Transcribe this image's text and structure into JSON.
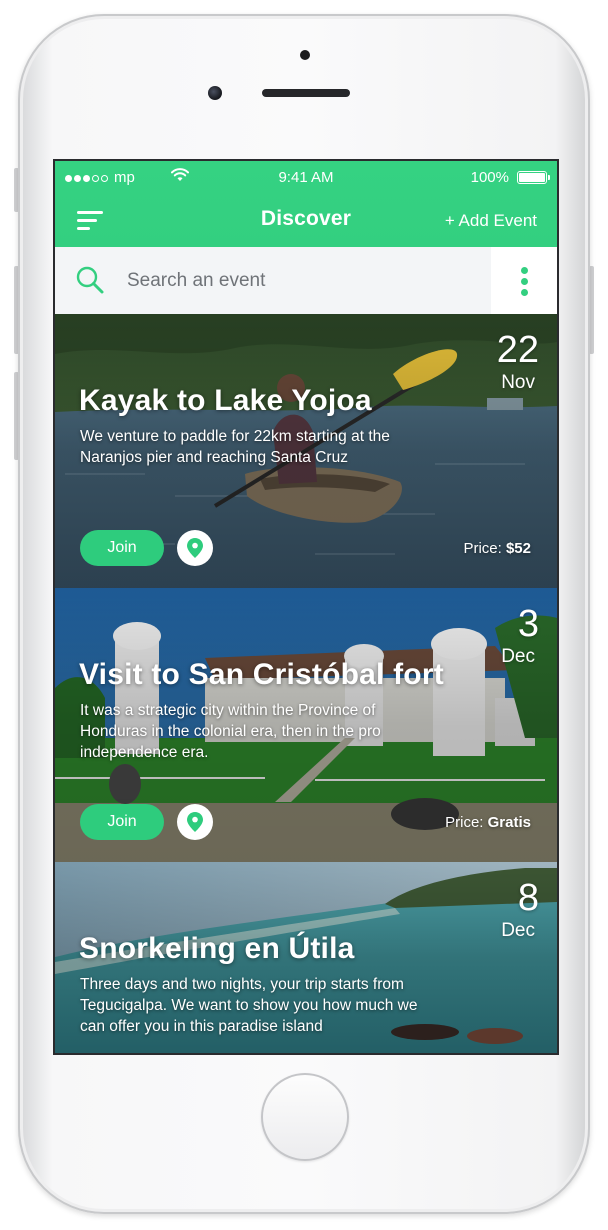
{
  "status_bar": {
    "carrier": "mp",
    "time": "9:41 AM",
    "battery": "100%"
  },
  "nav": {
    "title": "Discover",
    "add_event_label": "+ Add Event",
    "menu_icon": "hamburger-menu-icon"
  },
  "search": {
    "placeholder": "Search an event",
    "value": ""
  },
  "events": [
    {
      "day": "22",
      "month": "Nov",
      "title": "Kayak to Lake Yojoa",
      "description": "We venture to paddle for 22km starting at the Naranjos pier and reaching Santa Cruz",
      "join_label": "Join",
      "price_label": "Price:",
      "price_value": "$52"
    },
    {
      "day": "3",
      "month": "Dec",
      "title": "Visit to San Cristóbal fort",
      "description": "It was a strategic city within the Province of Honduras in the colonial era, then in the pro independence era.",
      "join_label": "Join",
      "price_label": "Price:",
      "price_value": "Gratis"
    },
    {
      "day": "8",
      "month": "Dec",
      "title": "Snorkeling en Útila",
      "description": "Three days and two nights, your trip starts from Tegucigalpa. We want to show you how much we can offer you in this paradise island"
    }
  ],
  "colors": {
    "accent": "#33CF80",
    "search_bg": "#F3F5F7"
  }
}
